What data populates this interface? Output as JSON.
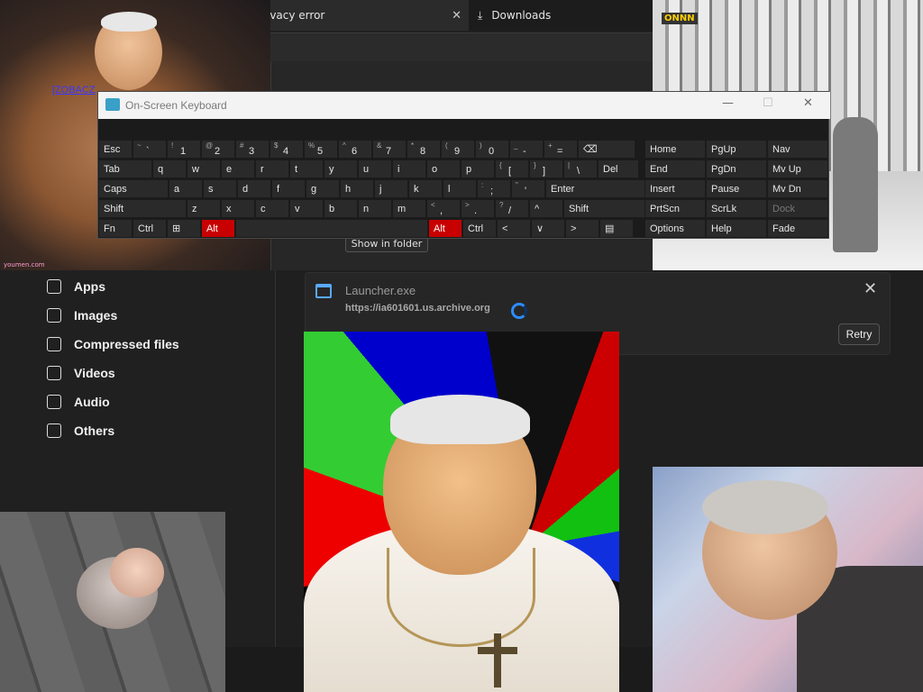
{
  "browser": {
    "tabs": [
      {
        "label": "ivacy error"
      },
      {
        "label": "Downloads"
      }
    ],
    "close_glyph": "✕",
    "download_glyph": "⤓"
  },
  "downloads": {
    "show_in_folder": "Show in folder",
    "sidebar": [
      {
        "label": "Apps",
        "icon": "apps-icon"
      },
      {
        "label": "Images",
        "icon": "image-icon"
      },
      {
        "label": "Compressed files",
        "icon": "compressed-files-icon"
      },
      {
        "label": "Videos",
        "icon": "video-icon"
      },
      {
        "label": "Audio",
        "icon": "audio-icon"
      },
      {
        "label": "Others",
        "icon": "others-icon"
      }
    ],
    "item": {
      "file_name": "Launcher.exe",
      "url": "https://ia601601.us.archive.org",
      "retry": "Retry",
      "close": "✕"
    }
  },
  "overlay": {
    "link_text": "[ZOBACZ"
  },
  "keyboard": {
    "title": "On-Screen Keyboard",
    "minimize": "—",
    "maximize": "☐",
    "close": "✕",
    "row1": [
      {
        "main": "Esc"
      },
      {
        "sup": "~",
        "main": "`"
      },
      {
        "sup": "!",
        "main": "1"
      },
      {
        "sup": "@",
        "main": "2"
      },
      {
        "sup": "#",
        "main": "3"
      },
      {
        "sup": "$",
        "main": "4"
      },
      {
        "sup": "%",
        "main": "5"
      },
      {
        "sup": "^",
        "main": "6"
      },
      {
        "sup": "&",
        "main": "7"
      },
      {
        "sup": "*",
        "main": "8"
      },
      {
        "sup": "(",
        "main": "9"
      },
      {
        "sup": ")",
        "main": "0"
      },
      {
        "sup": "_",
        "main": "-"
      },
      {
        "sup": "+",
        "main": "="
      },
      {
        "main": "⌫"
      }
    ],
    "row2": [
      {
        "main": "Tab"
      },
      {
        "main": "q"
      },
      {
        "main": "w"
      },
      {
        "main": "e"
      },
      {
        "main": "r"
      },
      {
        "main": "t"
      },
      {
        "main": "y"
      },
      {
        "main": "u"
      },
      {
        "main": "i"
      },
      {
        "main": "o"
      },
      {
        "main": "p"
      },
      {
        "sup": "{",
        "main": "["
      },
      {
        "sup": "}",
        "main": "]"
      },
      {
        "sup": "|",
        "main": "\\"
      },
      {
        "main": "Del"
      }
    ],
    "row3": [
      {
        "main": "Caps"
      },
      {
        "main": "a"
      },
      {
        "main": "s"
      },
      {
        "main": "d"
      },
      {
        "main": "f"
      },
      {
        "main": "g"
      },
      {
        "main": "h"
      },
      {
        "main": "j"
      },
      {
        "main": "k"
      },
      {
        "main": "l"
      },
      {
        "sup": ":",
        "main": ";"
      },
      {
        "sup": "\"",
        "main": "'"
      },
      {
        "main": "Enter"
      }
    ],
    "row4": [
      {
        "main": "Shift"
      },
      {
        "main": "z"
      },
      {
        "main": "x"
      },
      {
        "main": "c"
      },
      {
        "main": "v"
      },
      {
        "main": "b"
      },
      {
        "main": "n"
      },
      {
        "main": "m"
      },
      {
        "sup": "<",
        "main": ","
      },
      {
        "sup": ">",
        "main": "."
      },
      {
        "sup": "?",
        "main": "/"
      },
      {
        "main": "^"
      },
      {
        "main": "Shift"
      }
    ],
    "row5": [
      {
        "main": "Fn"
      },
      {
        "main": "Ctrl"
      },
      {
        "main": "⊞"
      },
      {
        "main": "Alt"
      },
      {
        "main": ""
      },
      {
        "main": "Alt"
      },
      {
        "main": "Ctrl"
      },
      {
        "main": "<"
      },
      {
        "main": "∨"
      },
      {
        "main": ">"
      },
      {
        "main": "▤"
      }
    ],
    "nav": [
      [
        "Home",
        "PgUp",
        "Nav"
      ],
      [
        "End",
        "PgDn",
        "Mv Up"
      ],
      [
        "Insert",
        "Pause",
        "Mv Dn"
      ],
      [
        "PrtScn",
        "ScrLk",
        "Dock"
      ],
      [
        "Options",
        "Help",
        "Fade"
      ]
    ],
    "highlight_color": "#c80000"
  },
  "photos": {
    "watermark": "youmen.com",
    "store_logo": "ONNN"
  }
}
